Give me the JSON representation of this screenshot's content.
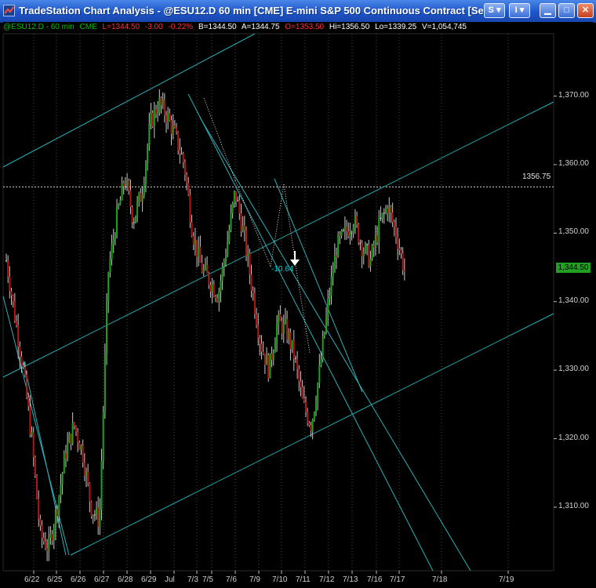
{
  "window": {
    "title": "TradeStation Chart Analysis - @ESU12.D 60 min [CME] E-mini S&P 500 Continuous Contract [Sep12]",
    "buttons": {
      "s": "S",
      "i": "I",
      "minimize": "",
      "maximize": "",
      "close": ""
    }
  },
  "status": {
    "symbol": "@ESU12.D - 60 min",
    "exchange": "CME",
    "last": "L=1344.50",
    "net": "-3.00",
    "pct": "-0.22%",
    "bid": "B=1344.50",
    "ask": "A=1344.75",
    "open": "O=1353.50",
    "high": "Hi=1356.50",
    "low": "Lo=1339.25",
    "volume": "V=1,054,745"
  },
  "colors": {
    "background": "#000000",
    "up_bar": "#1fa01f",
    "down_bar": "#b01818",
    "flat_bar": "#c8c8c8",
    "trendline": "#2ab0b8",
    "grid": "#4a4a4a"
  },
  "annotations": {
    "horizontal_line_value": "1356.75",
    "distance_label": "-10.64",
    "last_price_label": "1,344.50"
  },
  "chart_data": {
    "type": "candlestick",
    "y_ticks": [
      "1,370.00",
      "1,360.00",
      "1,350.00",
      "1,340.00",
      "1,330.00",
      "1,320.00",
      "1,310.00"
    ],
    "x_ticks": [
      "6/22",
      "6/25",
      "6/26",
      "6/27",
      "6/28",
      "6/29",
      "Jul",
      "7/3",
      "7/5",
      "7/6",
      "7/9",
      "7/10",
      "7/11",
      "7/12",
      "7/13",
      "7/16",
      "7/17",
      "7/18",
      "7/19"
    ],
    "ylim": [
      1301,
      1379
    ],
    "swing_closes": [
      1346,
      1338,
      1330,
      1320,
      1306,
      1304,
      1310,
      1318,
      1322,
      1318,
      1310,
      1308,
      1344,
      1352,
      1358,
      1352,
      1356,
      1366,
      1369,
      1367,
      1364,
      1360,
      1350,
      1345,
      1343,
      1341,
      1348,
      1356,
      1350,
      1342,
      1334,
      1330,
      1337,
      1336,
      1332,
      1325,
      1322,
      1330,
      1340,
      1348,
      1350,
      1352,
      1348,
      1346,
      1351,
      1354,
      1350,
      1344.5
    ]
  }
}
